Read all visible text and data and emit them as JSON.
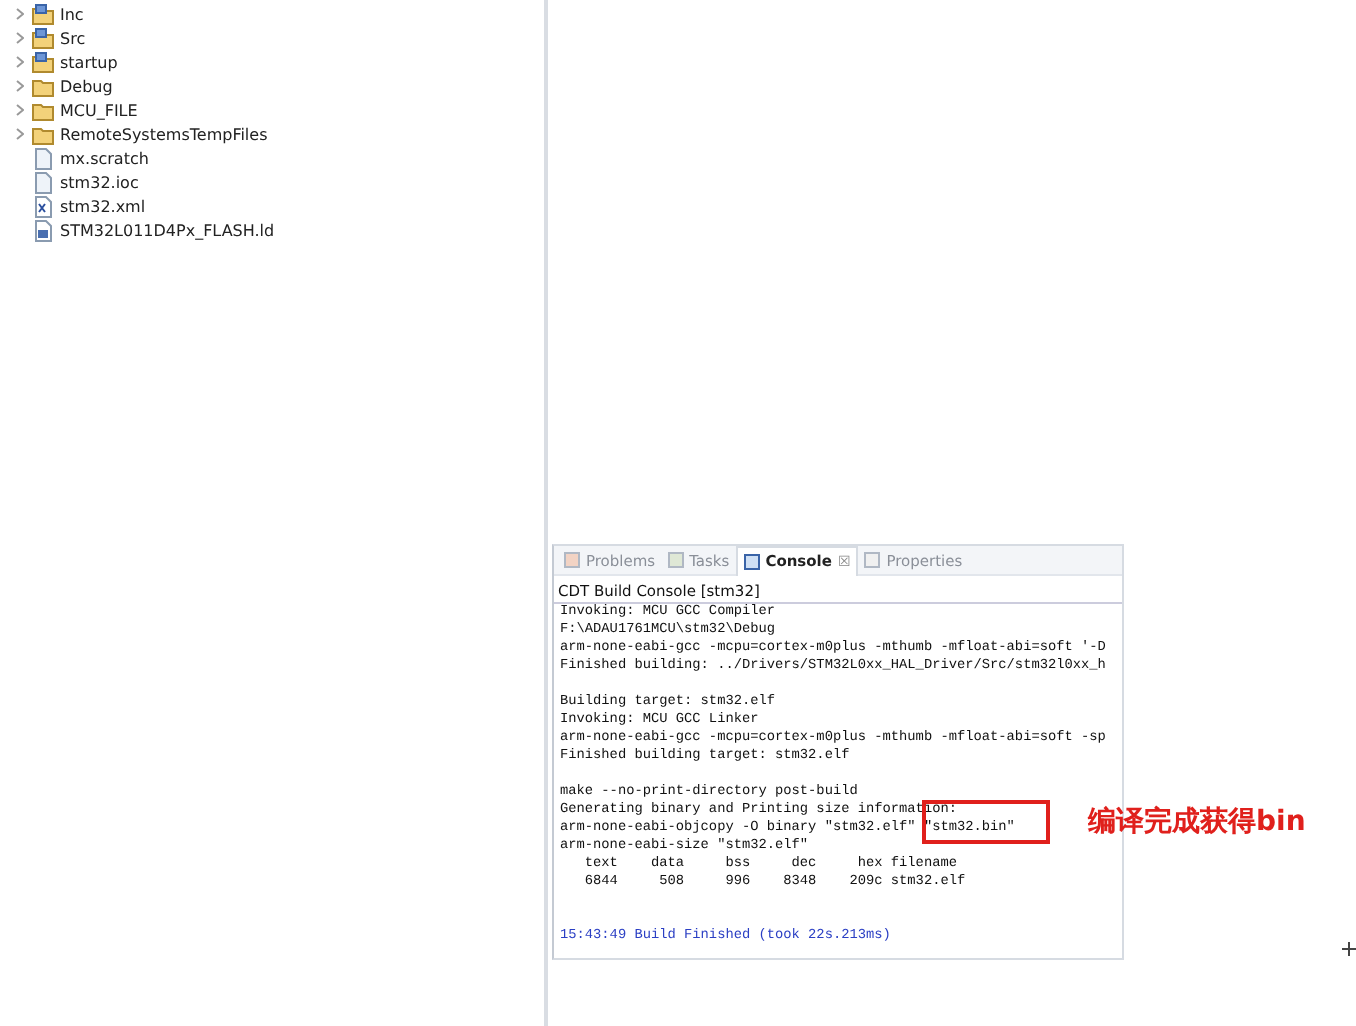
{
  "project_tree": [
    {
      "label": "Inc",
      "kind": "source-folder",
      "expandable": true
    },
    {
      "label": "Src",
      "kind": "source-folder",
      "expandable": true
    },
    {
      "label": "startup",
      "kind": "source-folder",
      "expandable": true
    },
    {
      "label": "Debug",
      "kind": "folder",
      "expandable": true
    },
    {
      "label": "MCU_FILE",
      "kind": "folder",
      "expandable": true
    },
    {
      "label": "RemoteSystemsTempFiles",
      "kind": "folder",
      "expandable": true
    },
    {
      "label": "mx.scratch",
      "kind": "file",
      "expandable": false
    },
    {
      "label": "stm32.ioc",
      "kind": "file",
      "expandable": false
    },
    {
      "label": "stm32.xml",
      "kind": "xml",
      "expandable": false
    },
    {
      "label": "STM32L011D4Px_FLASH.ld",
      "kind": "linker",
      "expandable": false
    }
  ],
  "console_tabs": [
    {
      "label": "Problems",
      "selected": false
    },
    {
      "label": "Tasks",
      "selected": false
    },
    {
      "label": "Console",
      "selected": true,
      "close": "☒"
    },
    {
      "label": "Properties",
      "selected": false
    }
  ],
  "console_title": "CDT Build Console [stm32]",
  "console_lines": [
    {
      "text": "Invoking: MCU GCC Compiler",
      "kind": "out"
    },
    {
      "text": "F:\\ADAU1761MCU\\stm32\\Debug",
      "kind": "out"
    },
    {
      "text": "arm-none-eabi-gcc -mcpu=cortex-m0plus -mthumb -mfloat-abi=soft '-D",
      "kind": "out"
    },
    {
      "text": "Finished building: ../Drivers/STM32L0xx_HAL_Driver/Src/stm32l0xx_h",
      "kind": "out"
    },
    {
      "kind": "blank"
    },
    {
      "text": "Building target: stm32.elf",
      "kind": "out"
    },
    {
      "text": "Invoking: MCU GCC Linker",
      "kind": "out"
    },
    {
      "text": "arm-none-eabi-gcc -mcpu=cortex-m0plus -mthumb -mfloat-abi=soft -sp",
      "kind": "out"
    },
    {
      "text": "Finished building target: stm32.elf",
      "kind": "out"
    },
    {
      "kind": "blank"
    },
    {
      "text": "make --no-print-directory post-build",
      "kind": "out"
    },
    {
      "text": "Generating binary and Printing size information:",
      "kind": "out"
    },
    {
      "text": "arm-none-eabi-objcopy -O binary \"stm32.elf\" \"stm32.bin\"",
      "kind": "out"
    },
    {
      "text": "arm-none-eabi-size \"stm32.elf\"",
      "kind": "out"
    },
    {
      "text": "   text    data     bss     dec     hex filename",
      "kind": "out"
    },
    {
      "text": "   6844     508     996    8348    209c stm32.elf",
      "kind": "out"
    },
    {
      "kind": "blank"
    },
    {
      "kind": "blank"
    },
    {
      "text": "15:43:49 Build Finished (took 22s.213ms)",
      "kind": "info"
    }
  ],
  "annotation": {
    "label": "编译完成获得bin"
  }
}
